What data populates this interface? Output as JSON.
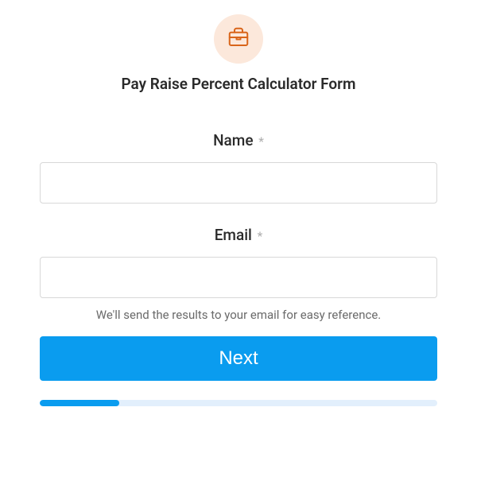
{
  "header": {
    "icon_name": "briefcase-icon",
    "title": "Pay Raise Percent Calculator Form"
  },
  "fields": {
    "name": {
      "label": "Name",
      "required_mark": "*",
      "value": ""
    },
    "email": {
      "label": "Email",
      "required_mark": "*",
      "value": "",
      "helper": "We'll send the results to your email for easy reference."
    }
  },
  "actions": {
    "next_label": "Next"
  },
  "progress": {
    "percent": 20
  },
  "colors": {
    "accent": "#0a9cef",
    "icon_bg": "#fce8db",
    "icon_stroke": "#d9651a"
  }
}
